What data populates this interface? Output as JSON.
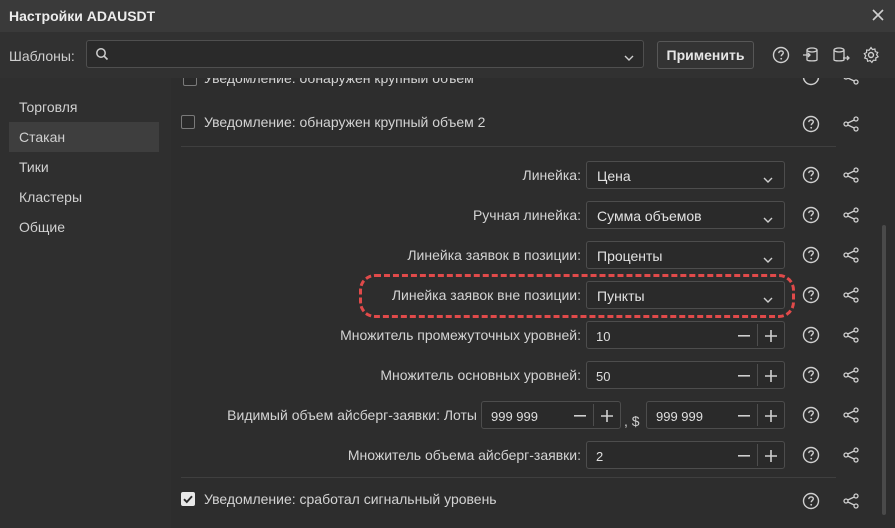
{
  "window": {
    "title": "Настройки ADAUSDT"
  },
  "toolbar": {
    "templates_label": "Шаблоны:",
    "templates_value": "",
    "apply_label": "Применить"
  },
  "sidebar": {
    "items": [
      {
        "label": "Торговля"
      },
      {
        "label": "Стакан",
        "active": true
      },
      {
        "label": "Тики"
      },
      {
        "label": "Кластеры"
      },
      {
        "label": "Общие"
      }
    ]
  },
  "content": {
    "partial_row_label": "Уведомление: обнаружен крупный объем",
    "notify_large_2": {
      "label": "Уведомление: обнаружен крупный объем 2",
      "checked": false
    },
    "ruler": {
      "label": "Линейка:",
      "value": "Цена"
    },
    "manual_ruler": {
      "label": "Ручная линейка:",
      "value": "Сумма объемов"
    },
    "ruler_orders_in_pos": {
      "label": "Линейка заявок в позиции:",
      "value": "Проценты"
    },
    "ruler_orders_out_pos": {
      "label": "Линейка заявок вне позиции:",
      "value": "Пункты"
    },
    "mult_intermediate": {
      "label": "Множитель промежуточных уровней:",
      "value": "10"
    },
    "mult_main": {
      "label": "Множитель основных уровней:",
      "value": "50"
    },
    "iceberg_visible": {
      "label": "Видимый объем айсберг-заявки: Лоты",
      "lots": "999 999",
      "dollar_sep": ", $",
      "dollars": "999 999"
    },
    "iceberg_mult": {
      "label": "Множитель объема айсберг-заявки:",
      "value": "2"
    },
    "notify_signal": {
      "label": "Уведомление: сработал сигнальный уровень",
      "checked": true
    }
  },
  "colors": {
    "highlight": "#e04a4a",
    "accent_text": "#d6d6d6"
  },
  "icons": [
    "close-icon",
    "search-icon",
    "chevron-down-icon",
    "help-icon",
    "import-icon",
    "export-icon",
    "settings-icon",
    "share-icon",
    "minus-icon",
    "plus-icon",
    "check-icon"
  ]
}
